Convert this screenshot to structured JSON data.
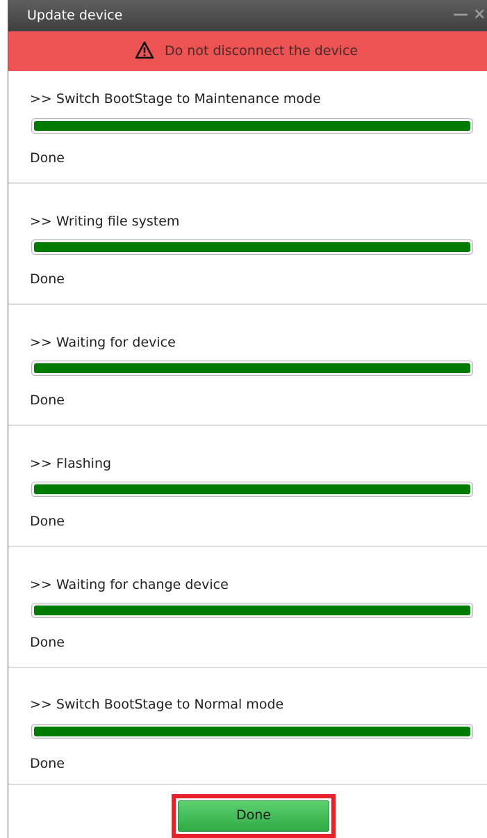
{
  "window": {
    "title": "Update device",
    "minimize_glyph": "—",
    "close_glyph": "×"
  },
  "warning": {
    "text": "Do not disconnect the device",
    "icon": "warning-icon",
    "color": "#ed5353"
  },
  "steps": [
    {
      "label": ">> Switch BootStage to Maintenance mode",
      "progress": 1.0,
      "status": "Done"
    },
    {
      "label": ">> Writing file system",
      "progress": 1.0,
      "status": "Done"
    },
    {
      "label": ">> Waiting for device",
      "progress": 1.0,
      "status": "Done"
    },
    {
      "label": ">> Flashing",
      "progress": 1.0,
      "status": "Done"
    },
    {
      "label": ">> Waiting for change device",
      "progress": 1.0,
      "status": "Done"
    },
    {
      "label": ">> Switch BootStage to Normal mode",
      "progress": 1.0,
      "status": "Done"
    }
  ],
  "progress_color": "#007a00",
  "footer": {
    "done_label": "Done",
    "highlight_color": "#e8202a"
  }
}
